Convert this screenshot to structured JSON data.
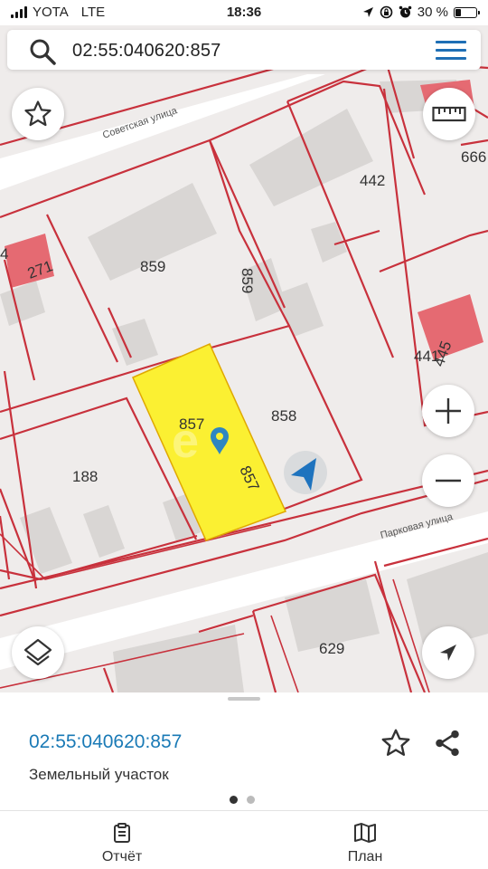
{
  "status_bar": {
    "carrier": "YOTA",
    "network": "LTE",
    "time": "18:36",
    "battery_text": "30 %",
    "battery_level": 0.3,
    "icons": [
      "location-arrow-icon",
      "screen-lock-icon",
      "alarm-clock-icon"
    ]
  },
  "search": {
    "value": "02:55:040620:857",
    "icon": "search-icon",
    "menu_icon": "hamburger-menu-icon"
  },
  "map": {
    "street_labels": [
      "Советская улица",
      "Парковая улица"
    ],
    "parcel_labels": [
      "442",
      "666",
      "859",
      "859",
      "271",
      "4",
      "441",
      "445",
      "857",
      "858",
      "857",
      "188",
      "629"
    ],
    "selected_parcel_color": "#fbf032",
    "boundary_color": "#c8313c",
    "marker_color": "#2e86c1",
    "controls": {
      "favorite": "star-icon",
      "ruler": "ruler-icon",
      "zoom_in": "plus-icon",
      "zoom_out": "minus-icon",
      "layers": "layers-icon",
      "locate": "navigation-arrow-icon"
    }
  },
  "sheet": {
    "parcel_id": "02:55:040620:857",
    "parcel_type": "Земельный участок",
    "accent_color": "#1a7ab6",
    "page_count": 2,
    "active_page": 1
  },
  "tabs": [
    {
      "label": "Отчёт",
      "icon": "clipboard-icon"
    },
    {
      "label": "План",
      "icon": "map-icon"
    }
  ]
}
